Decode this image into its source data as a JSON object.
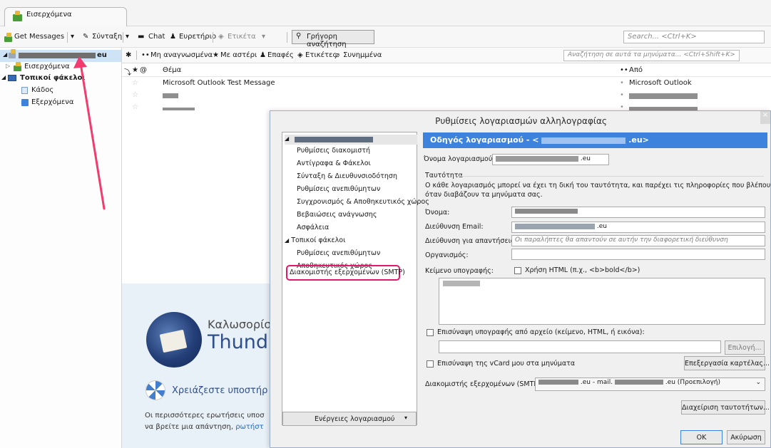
{
  "tab": {
    "title": "Εισερχόμενα"
  },
  "toolbar": {
    "get_messages": "Get Messages",
    "compose": "Σύνταξη",
    "chat": "Chat",
    "address_book": "Ευρετήριο",
    "tag": "Ετικέτα",
    "quick_search": "Γρήγορη αναζήτηση",
    "search_placeholder": "Search... <Ctrl+K>"
  },
  "folders": {
    "account_suffix": "eu",
    "inbox": "Εισερχόμενα",
    "local_folders": "Τοπικοί φάκελοι",
    "trash": "Κάδος",
    "outbox": "Εξερχόμενα"
  },
  "filter_bar": {
    "unread": "Μη αναγνωσμένα",
    "starred": "Με αστέρι",
    "contacts": "Επαφές",
    "tags": "Ετικέτες",
    "attachments": "Συνημμένα",
    "search_placeholder": "Αναζήτηση σε αυτά τα μηνύματα... <Ctrl+Shift+K>"
  },
  "thread": {
    "col_subject": "Θέμα",
    "col_from": "Από",
    "messages": [
      {
        "subject": "Microsoft Outlook Test Message",
        "from": "Microsoft Outlook"
      }
    ]
  },
  "welcome": {
    "heading_line1": "Καλωσορίσατ",
    "heading_line2": "Thund",
    "help_title": "Χρειάζεστε υποστήρ",
    "help_text1": "Οι περισσότερες ερωτήσεις υποσ",
    "help_text2": "να βρείτε μια απάντηση,",
    "help_link": "ρωτήστ"
  },
  "dialog": {
    "title": "Ρυθμίσεις λογαριασμών αλληλογραφίας",
    "close": "×",
    "tree": {
      "account_items": [
        "Ρυθμίσεις διακομιστή",
        "Αντίγραφα & Φάκελοι",
        "Σύνταξη & Διευθυνσιοδότηση",
        "Ρυθμίσεις ανεπιθύμητων",
        "Συγχρονισμός & Αποθηκευτικός χώρος",
        "Βεβαιώσεις ανάγνωσης",
        "Ασφάλεια"
      ],
      "local_folders": "Τοπικοί φάκελοι",
      "local_items": [
        "Ρυθμίσεις ανεπιθύμητων",
        "Αποθηκευτικός χώρος"
      ],
      "smtp": "Διακομιστής εξερχομένων (SMTP)"
    },
    "account_actions": "Ενέργειες λογαριασμού",
    "panel": {
      "header_prefix": "Οδηγός λογαριασμού - <",
      "header_suffix": ".eu>",
      "account_name_label": "Όνομα λογαριασμού:",
      "account_name_suffix": ".eu",
      "identity_title": "Ταυτότητα",
      "identity_desc1": "Ο κάθε λογαριασμός μπορεί να έχει τη δική του ταυτότητα, και παρέχει τις πληροφορίες που βλέπουν τρίτοι",
      "identity_desc2": "όταν διαβάζουν τα μηνύματα σας.",
      "name_label": "Όνομα:",
      "email_label": "Διεύθυνση Email:",
      "email_suffix": ".eu",
      "reply_label": "Διεύθυνση για απαντήσεις:",
      "reply_placeholder": "Οι παραλήπτες θα απαντούν σε αυτήν την διαφορετική διεύθυνση",
      "org_label": "Οργανισμός:",
      "sig_label": "Κείμενο υπογραφής:",
      "html_check": "Χρήση HTML (π.χ., <b>bold</b>)",
      "attach_sig": "Επισύναψη υπογραφής από αρχείο (κείμενο, HTML, ή εικόνα):",
      "choose": "Επιλογή...",
      "vcard": "Επισύναψη της vCard μου στα μηνύματα",
      "edit_card": "Επεξεργασία καρτέλας...",
      "smtp_label": "Διακομιστής εξερχομένων (SMTP):",
      "smtp_value_mid": ".eu - mail.",
      "smtp_value_end": ".eu (Προεπιλογή)",
      "manage_ids": "Διαχείριση ταυτοτήτων...",
      "ok": "OK",
      "cancel": "Ακύρωση"
    }
  },
  "colors": {
    "accent_header": "#3d82dc",
    "highlight_red": "#e2186a",
    "arrow": "#f03c6e"
  }
}
